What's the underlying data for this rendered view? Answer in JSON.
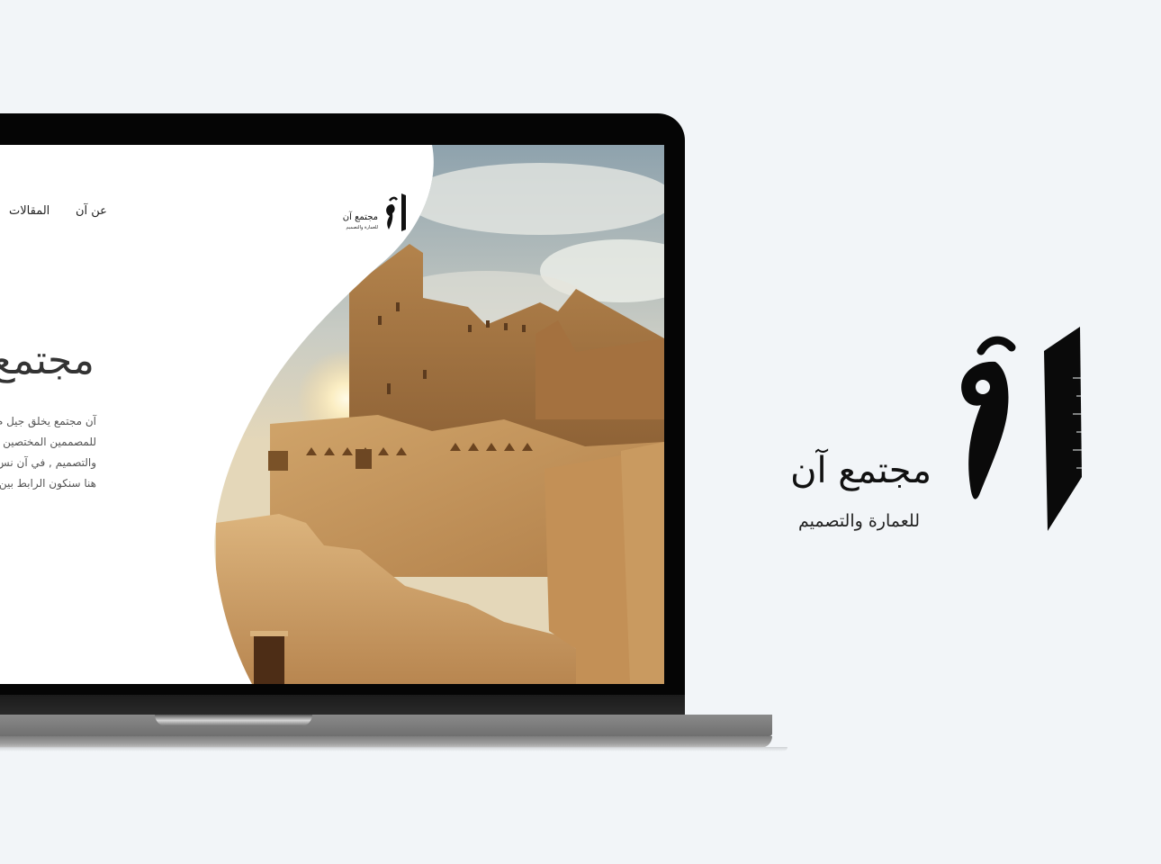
{
  "website": {
    "nav": {
      "about_label": "عن آن",
      "articles_label": "المقالات"
    },
    "logo": {
      "name": "مجتمع آن",
      "tagline": "للعمارة والتصميم"
    },
    "hero": {
      "title": "مجتمع",
      "paragraph_lines": [
        "آن مجتمع يخلق جيل م",
        "للمصممين المختصين و",
        "والتصميم , في آن نس",
        "هنا سنكون الرابط بين"
      ]
    },
    "hero_image": {
      "icon": "heritage-mud-building-photo"
    }
  },
  "brand_logo": {
    "name": "مجتمع آن",
    "tagline": "للعمارة والتصميم",
    "icon": "aan-calligraphy-mark"
  },
  "colors": {
    "page_background": "#f2f5f8",
    "laptop_bezel": "#050505",
    "text_dark": "#111111",
    "sand": "#b98a52"
  }
}
